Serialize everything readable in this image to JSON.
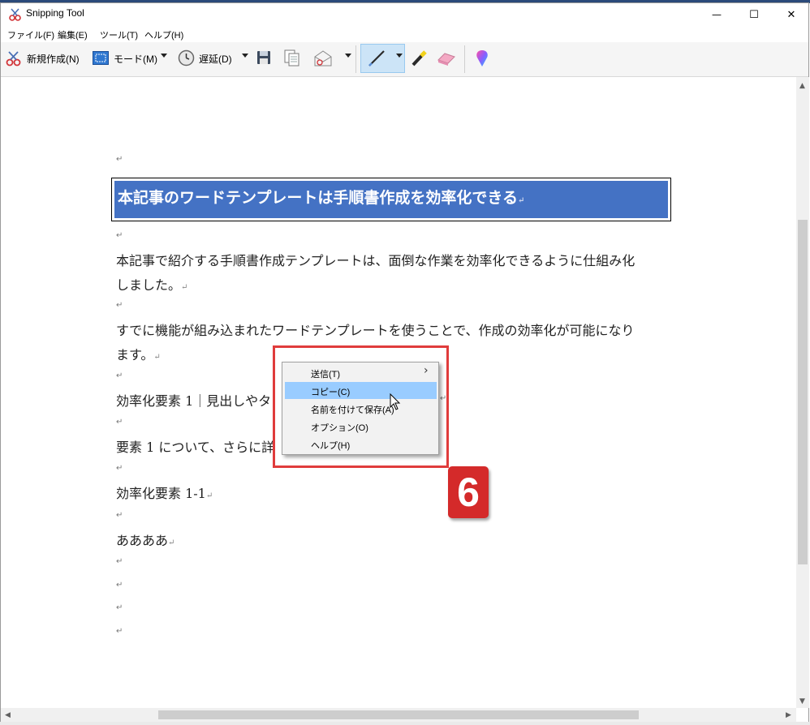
{
  "window": {
    "title": "Snipping Tool",
    "controls": {
      "minimize": "—",
      "maximize": "☐",
      "close": "✕"
    }
  },
  "menu": [
    "ファイル(F)",
    "編集(E)",
    "ツール(T)",
    "ヘルプ(H)"
  ],
  "toolbar": {
    "new_label": "新規作成(N)",
    "mode_label": "モード(M)",
    "delay_label": "遅延(D)"
  },
  "document": {
    "return_mark": "↵",
    "heading": "本記事のワードテンプレートは手順書作成を効率化できる",
    "p1_line1": "本記事で紹介する手順書作成テンプレートは、面倒な作業を効率化できるように仕組み化",
    "p1_line2": "しました。",
    "p2_line1": "すでに機能が組み込まれたワードテンプレートを使うことで、作成の効率化が可能になり",
    "p2_line2": "ます。",
    "p3": "効率化要素 1｜見出しやタ",
    "p4": "要素 1 について、さらに詳",
    "p5": "効率化要素 1-1",
    "p6": "ああああ"
  },
  "context_menu": {
    "items": [
      "送信(T)",
      "コピー(C)",
      "名前を付けて保存(A)",
      "オプション(O)",
      "ヘルプ(H)"
    ],
    "submenu_arrow": "›",
    "selected": "コピー(C)"
  },
  "step_badge": "6",
  "colors": {
    "heading_bg": "#4472c4",
    "highlight_border": "#e03c3c",
    "badge": "#d42a2a",
    "menu_selected": "#99ccff"
  }
}
